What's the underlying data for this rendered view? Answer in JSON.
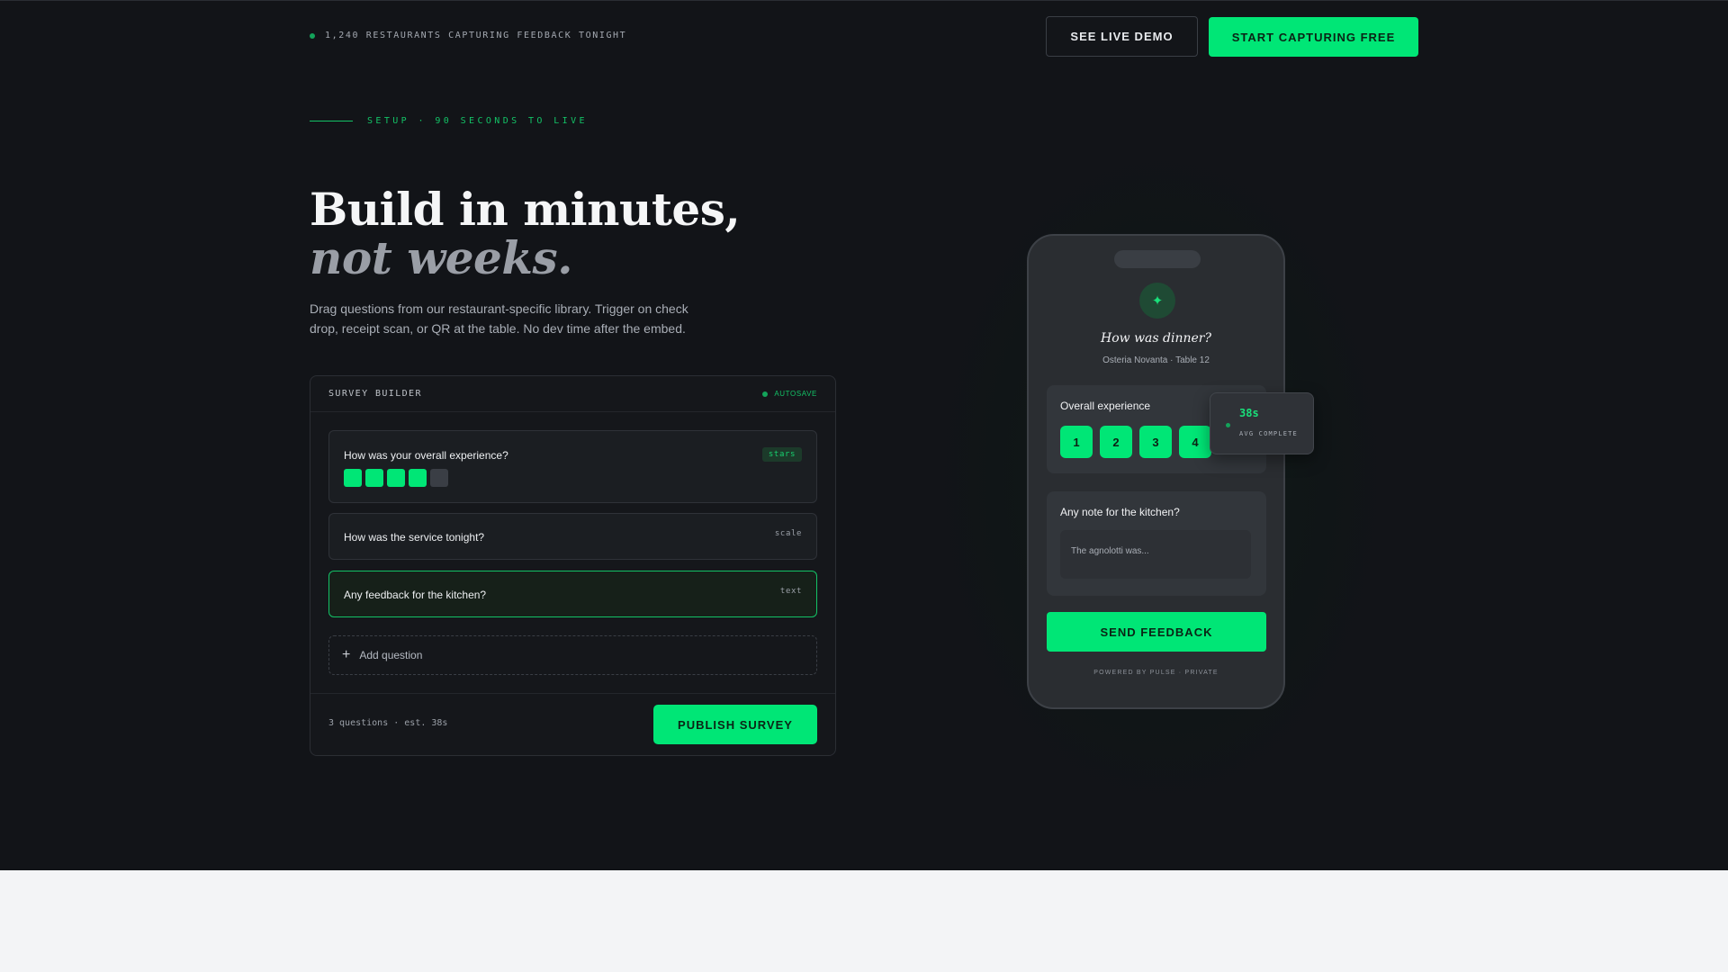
{
  "topbar": {
    "live_status": "1,240 RESTAURANTS CAPTURING FEEDBACK TONIGHT",
    "demo_button": "SEE LIVE DEMO",
    "start_button": "START CAPTURING FREE"
  },
  "hero": {
    "eyebrow": "SETUP · 90 SECONDS TO LIVE",
    "title_line1": "Build in minutes,",
    "title_line2": "not weeks.",
    "lead": "Drag questions from our restaurant-specific library. Trigger on check drop, receipt scan, or QR at the table. No dev time after the embed."
  },
  "builder": {
    "title": "SURVEY BUILDER",
    "autosave": "AUTOSAVE",
    "questions": [
      {
        "label": "How was your overall experience?",
        "type": "stars",
        "rating": 4,
        "max": 5
      },
      {
        "label": "How was the service tonight?",
        "type": "scale"
      },
      {
        "label": "Any feedback for the kitchen?",
        "type": "text"
      }
    ],
    "add_question": "Add question",
    "footer_meta": "3 questions · est. 38s",
    "publish_button": "PUBLISH SURVEY"
  },
  "phone": {
    "title": "How was dinner?",
    "subtitle": "Osteria Novanta · Table 12",
    "card1_label": "Overall experience",
    "rating_options": [
      "1",
      "2",
      "3",
      "4"
    ],
    "card2_label": "Any note for the kitchen?",
    "note_placeholder": "The agnolotti was...",
    "send_button": "SEND FEEDBACK",
    "powered_by": "POWERED BY PULSE · PRIVATE",
    "icon": "sparkle-icon"
  },
  "toast": {
    "value": "38s",
    "label": "AVG COMPLETE"
  },
  "colors": {
    "accent": "#00e676",
    "background": "#121418",
    "page_below": "#f3f4f6"
  }
}
